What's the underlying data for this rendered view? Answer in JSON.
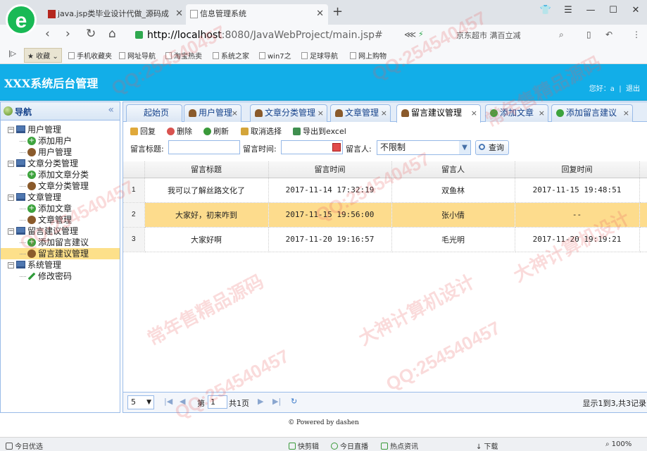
{
  "browser": {
    "tabs": [
      {
        "label": "java.jsp类毕业设计代做_源码成"
      },
      {
        "label": "信息管理系统"
      }
    ],
    "url_host": "http://localhost",
    "url_rest": ":8080/JavaWebProject/main.jsp#",
    "address_right": "京东超市 满百立减",
    "bookmarks": [
      "收藏",
      "手机收藏夹",
      "网址导航",
      "淘宝热卖",
      "系统之家",
      "win7之",
      "足球导航",
      "网上购物"
    ]
  },
  "app": {
    "title": "XXX系统后台管理",
    "greeting": "您好：a",
    "logout": "退出"
  },
  "sidebar": {
    "title": "导航",
    "groups": [
      {
        "label": "用户管理",
        "items": [
          "添加用户",
          "用户管理"
        ]
      },
      {
        "label": "文章分类管理",
        "items": [
          "添加文章分类",
          "文章分类管理"
        ]
      },
      {
        "label": "文章管理",
        "items": [
          "添加文章",
          "文章管理"
        ]
      },
      {
        "label": "留言建议管理",
        "items": [
          "添加留言建议",
          "留言建议管理"
        ]
      },
      {
        "label": "系统管理",
        "items": [
          "修改密码"
        ]
      }
    ]
  },
  "tabs": [
    "起始页",
    "用户管理",
    "文章分类管理",
    "文章管理",
    "留言建议管理",
    "添加文章",
    "添加留言建议"
  ],
  "toolbar": {
    "reply": "回复",
    "delete": "删除",
    "refresh": "刷新",
    "deselect": "取消选择",
    "export": "导出到excel"
  },
  "search": {
    "title_label": "留言标题:",
    "time_label": "留言时间:",
    "person_label": "留言人:",
    "person_value": "不限制",
    "query_button": "查询"
  },
  "grid": {
    "columns": [
      "留言标题",
      "留言时间",
      "留言人",
      "回复时间"
    ],
    "rows": [
      {
        "no": "1",
        "title": "我可以了解丝路文化了",
        "time": "2017-11-14 17:32:19",
        "person": "双鱼林",
        "reply": "2017-11-15 19:48:51"
      },
      {
        "no": "2",
        "title": "大家好，初来咋到",
        "time": "2017-11-15 19:56:00",
        "person": "张小倩",
        "reply": "--"
      },
      {
        "no": "3",
        "title": "大家好啊",
        "time": "2017-11-20 19:16:57",
        "person": "毛光明",
        "reply": "2017-11-20 19:19:21"
      }
    ]
  },
  "pager": {
    "page_size": "5",
    "page_prefix": "第",
    "page_number": "1",
    "page_suffix": "共1页",
    "info": "显示1到3,共3记录"
  },
  "footer": "© Powered by dashen",
  "statusbar": {
    "left": "今日优选",
    "items": [
      "快剪辑",
      "今日直播",
      "热点资讯",
      "下载",
      "100%"
    ]
  },
  "watermarks": [
    "QQ:254540457",
    "常年售精品源码",
    "大神计算机设计"
  ]
}
